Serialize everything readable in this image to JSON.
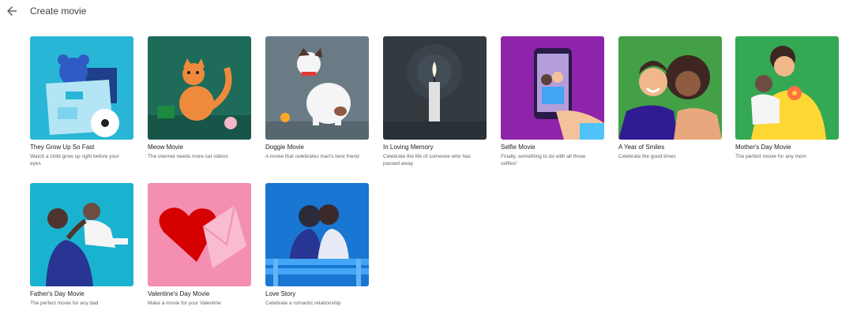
{
  "header": {
    "title": "Create movie",
    "back_icon": "arrow-back-icon"
  },
  "cards": [
    {
      "name": "They Grow Up So Fast",
      "desc": "Watch a child grow up right before your eyes",
      "bg": "#29b6d6"
    },
    {
      "name": "Meow Movie",
      "desc": "The internet needs more cat videos",
      "bg": "#1e6b5a"
    },
    {
      "name": "Doggie Movie",
      "desc": "A movie that celebrates man's best friend",
      "bg": "#6b7b86"
    },
    {
      "name": "In Loving Memory",
      "desc": "Celebrate the life of someone who has passed away",
      "bg": "#323a40"
    },
    {
      "name": "Selfie Movie",
      "desc": "Finally, something to do with all those selfies!",
      "bg": "#8e24aa"
    },
    {
      "name": "A Year of Smiles",
      "desc": "Celebrate the good times",
      "bg": "#43a047"
    },
    {
      "name": "Mother's Day Movie",
      "desc": "The perfect movie for any mom",
      "bg": "#34a853"
    },
    {
      "name": "Father's Day Movie",
      "desc": "The perfect movie for any dad",
      "bg": "#1ab3cf"
    },
    {
      "name": "Valentine's Day Movie",
      "desc": "Make a movie for your Valentine",
      "bg": "#f48fb1"
    },
    {
      "name": "Love Story",
      "desc": "Celebrate a romantic relationship",
      "bg": "#1976d2"
    }
  ]
}
